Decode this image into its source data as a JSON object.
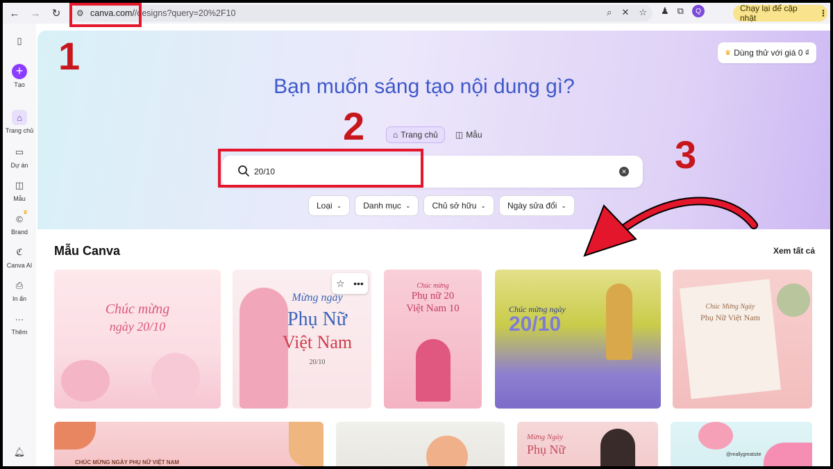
{
  "browser": {
    "url_host": "canva.com/",
    "url_path": "/designs?query=20%2F10",
    "profile_initial": "Q",
    "update_label": "Chạy lại để cập nhật"
  },
  "sidebar": {
    "items": [
      {
        "label": "Tạo"
      },
      {
        "label": "Trang chủ"
      },
      {
        "label": "Dự án"
      },
      {
        "label": "Mẫu"
      },
      {
        "label": "Brand"
      },
      {
        "label": "Canva AI"
      },
      {
        "label": "In ấn"
      },
      {
        "label": "Thêm"
      }
    ]
  },
  "header": {
    "trial_label": "Dùng thử với giá 0 ₫",
    "title": "Bạn muốn sáng tạo nội dung gì?"
  },
  "tabs": [
    {
      "label": "Trang chủ",
      "active": true
    },
    {
      "label": "Mẫu",
      "active": false
    }
  ],
  "search": {
    "value": "20/10"
  },
  "filters": [
    {
      "label": "Loại"
    },
    {
      "label": "Danh mục"
    },
    {
      "label": "Chủ sở hữu"
    },
    {
      "label": "Ngày sửa đổi"
    }
  ],
  "section": {
    "title": "Mẫu Canva",
    "see_all": "Xem tất cả"
  },
  "cards": [
    {
      "text1": "Chúc mừng",
      "text2": "ngày 20/10"
    },
    {
      "text1": "Mừng ngày",
      "text2": "Phụ Nữ",
      "text3": "Việt Nam",
      "text4": "20/10"
    },
    {
      "text1": "Chúc mừng",
      "text2": "Phụ nữ 20",
      "text3": "Việt Nam 10"
    },
    {
      "text1": "Chúc mừng ngày",
      "text2": "20/10"
    },
    {
      "text1": "Chúc Mừng Ngày",
      "text2": "Phụ Nữ Việt Nam"
    },
    {
      "text1": "CHÚC MỪNG NGÀY PHỤ NỮ VIỆT NAM"
    },
    {
      "text1": ""
    },
    {
      "text1": "Mừng Ngày",
      "text2": "Phụ Nữ"
    },
    {
      "text1": "@reallygreatsite"
    }
  ],
  "annotations": {
    "n1": "1",
    "n2": "2",
    "n3": "3"
  },
  "colors": {
    "accent": "#8b3dff",
    "title": "#3f58c9",
    "annotation": "#e4162b"
  }
}
